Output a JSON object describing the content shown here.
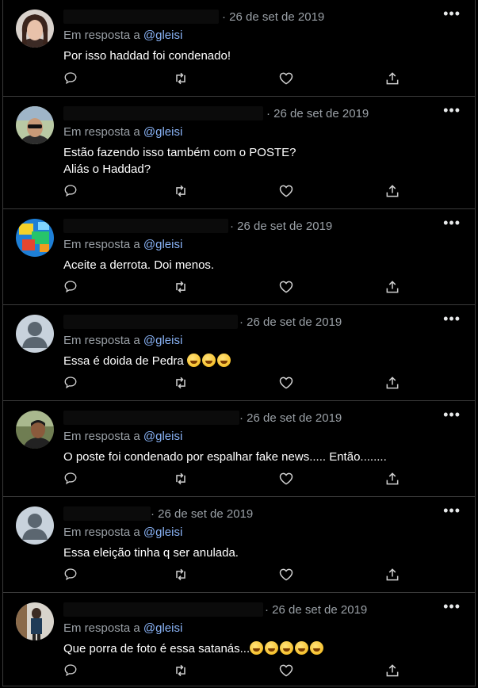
{
  "tweets": [
    {
      "date": "· 26 de set de 2019",
      "reply_prefix": "Em resposta a",
      "handle": "@gleisi",
      "text": "Por isso haddad foi condenado!",
      "avatar": "woman-photo"
    },
    {
      "date": "· 26 de set de 2019",
      "reply_prefix": "Em resposta a",
      "handle": "@gleisi",
      "text": "Estão fazendo isso também com o POSTE?",
      "text2": "Aliás o Haddad?",
      "avatar": "man-sunglasses-photo"
    },
    {
      "date": "· 26 de set de 2019",
      "reply_prefix": "Em resposta a",
      "handle": "@gleisi",
      "text": "Aceite a derrota. Doi menos.",
      "avatar": "colorful-photo"
    },
    {
      "date": "· 26 de set de 2019",
      "reply_prefix": "Em resposta a",
      "handle": "@gleisi",
      "text": "Essa é doida de Pedra",
      "emoji": "zany-face x3",
      "avatar": "default-avatar"
    },
    {
      "date": "· 26 de set de 2019",
      "reply_prefix": "Em resposta a",
      "handle": "@gleisi",
      "text": "O poste foi condenado por espalhar fake news..... Então........",
      "avatar": "man-outdoor-photo"
    },
    {
      "date": "· 26 de set de 2019",
      "reply_prefix": "Em resposta a",
      "handle": "@gleisi",
      "text": "Essa eleição tinha q ser anulada.",
      "avatar": "default-avatar"
    },
    {
      "date": "· 26 de set de 2019",
      "reply_prefix": "Em resposta a",
      "handle": "@gleisi",
      "text": "Que porra de foto é essa satanás...",
      "emoji": "rolling-laughing-face x5",
      "avatar": "person-photo"
    }
  ],
  "icons": {
    "reply": "reply-icon",
    "retweet": "retweet-icon",
    "like": "like-icon",
    "share": "share-icon",
    "more": "more-icon"
  },
  "colors": {
    "background": "#000000",
    "handle": "#8ab4f8",
    "muted": "#9aa0a6",
    "text": "#ffffff"
  }
}
